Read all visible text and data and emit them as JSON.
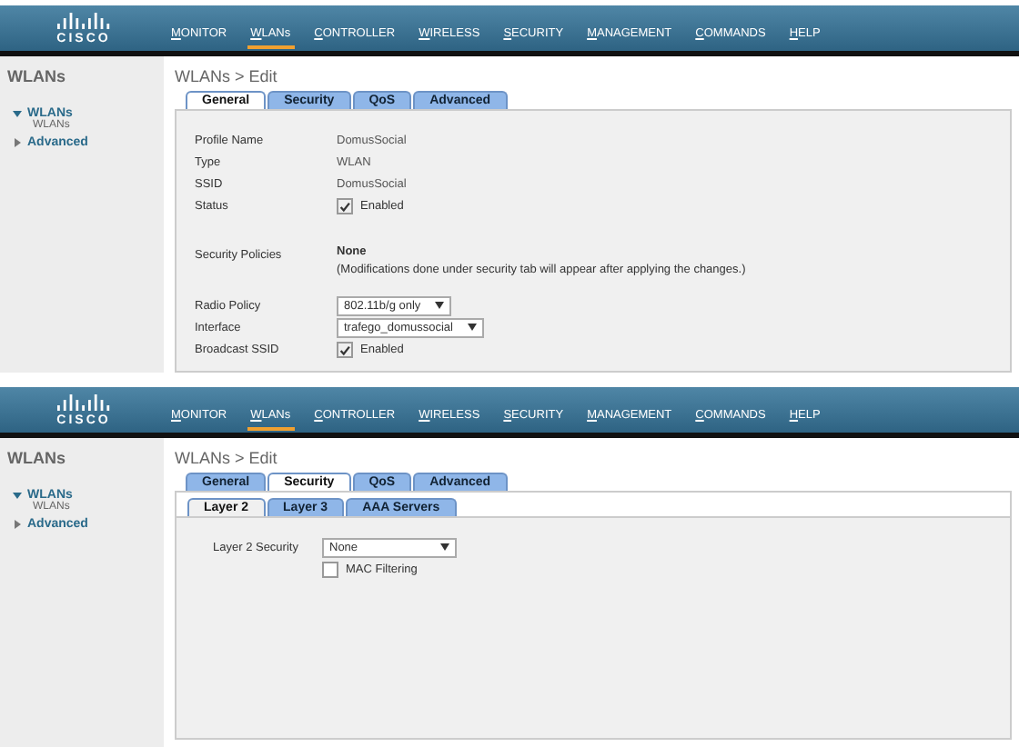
{
  "panels": [
    {
      "logo": "CISCO",
      "nav": [
        {
          "label": "MONITOR",
          "selected": false
        },
        {
          "label": "WLANs",
          "selected": true
        },
        {
          "label": "CONTROLLER",
          "selected": false
        },
        {
          "label": "WIRELESS",
          "selected": false
        },
        {
          "label": "SECURITY",
          "selected": false
        },
        {
          "label": "MANAGEMENT",
          "selected": false
        },
        {
          "label": "COMMANDS",
          "selected": false
        },
        {
          "label": "HELP",
          "selected": false
        }
      ],
      "sidebar": {
        "title": "WLANs",
        "items": [
          {
            "label": "WLANs",
            "expanded": true,
            "children": [
              {
                "label": "WLANs"
              }
            ]
          },
          {
            "label": "Advanced",
            "expanded": false
          }
        ]
      },
      "breadcrumb": "WLANs > Edit",
      "tabs": [
        {
          "label": "General",
          "selected": true
        },
        {
          "label": "Security",
          "selected": false
        },
        {
          "label": "QoS",
          "selected": false
        },
        {
          "label": "Advanced",
          "selected": false
        }
      ],
      "groups": [
        [
          {
            "kind": "text",
            "label": "Profile Name",
            "value": "DomusSocial"
          },
          {
            "kind": "text",
            "label": "Type",
            "value": "WLAN"
          },
          {
            "kind": "text",
            "label": "SSID",
            "value": "DomusSocial"
          },
          {
            "kind": "checkbox",
            "label": "Status",
            "checked": true,
            "text": "Enabled"
          }
        ],
        [
          {
            "kind": "policy",
            "label": "Security Policies",
            "value": "None",
            "note": "(Modifications done under security tab will appear after applying the changes.)"
          }
        ],
        [
          {
            "kind": "select",
            "label": "Radio Policy",
            "value": "802.11b/g only"
          },
          {
            "kind": "select",
            "label": "Interface",
            "value": "trafego_domussocial"
          },
          {
            "kind": "checkbox",
            "label": "Broadcast SSID",
            "checked": true,
            "text": "Enabled"
          }
        ]
      ]
    },
    {
      "logo": "CISCO",
      "nav": [
        {
          "label": "MONITOR",
          "selected": false
        },
        {
          "label": "WLANs",
          "selected": true
        },
        {
          "label": "CONTROLLER",
          "selected": false
        },
        {
          "label": "WIRELESS",
          "selected": false
        },
        {
          "label": "SECURITY",
          "selected": false
        },
        {
          "label": "MANAGEMENT",
          "selected": false
        },
        {
          "label": "COMMANDS",
          "selected": false
        },
        {
          "label": "HELP",
          "selected": false
        }
      ],
      "sidebar": {
        "title": "WLANs",
        "items": [
          {
            "label": "WLANs",
            "expanded": true,
            "children": [
              {
                "label": "WLANs"
              }
            ]
          },
          {
            "label": "Advanced",
            "expanded": false
          }
        ]
      },
      "breadcrumb": "WLANs > Edit",
      "tabs": [
        {
          "label": "General",
          "selected": false
        },
        {
          "label": "Security",
          "selected": true
        },
        {
          "label": "QoS",
          "selected": false
        },
        {
          "label": "Advanced",
          "selected": false
        }
      ],
      "subtabs": [
        {
          "label": "Layer 2",
          "selected": true
        },
        {
          "label": "Layer 3",
          "selected": false
        },
        {
          "label": "AAA Servers",
          "selected": false
        }
      ],
      "groups": [
        [
          {
            "kind": "select",
            "label": "Layer 2 Security",
            "value": "None"
          },
          {
            "kind": "checkbox",
            "checked": false,
            "text": "MAC Filtering"
          }
        ]
      ]
    }
  ]
}
